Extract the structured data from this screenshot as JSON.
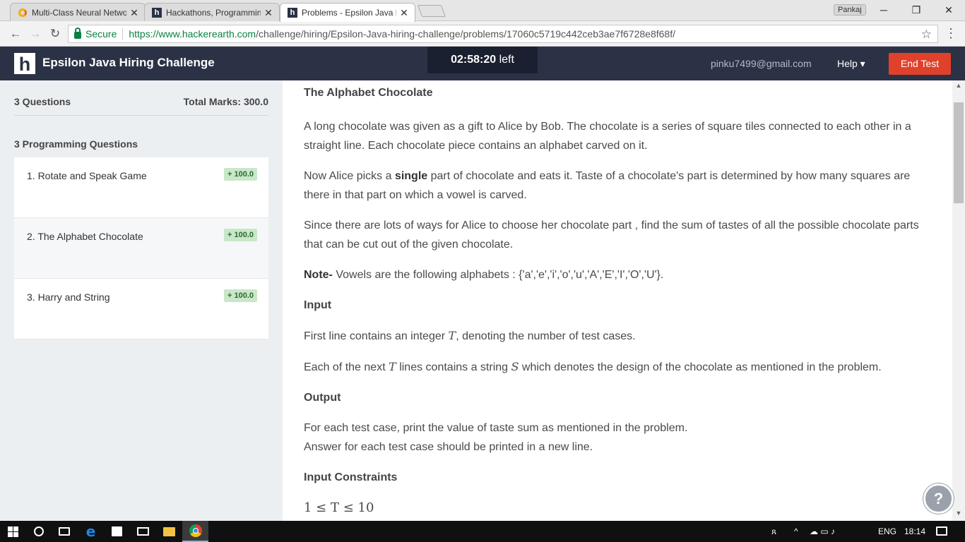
{
  "browser": {
    "tabs": [
      {
        "title": "Multi-Class Neural Netwo",
        "favicon": "colab-icon"
      },
      {
        "title": "Hackathons, Programmin",
        "favicon": "hackerearth-icon"
      },
      {
        "title": "Problems - Epsilon Java H",
        "favicon": "hackerearth-icon",
        "active": true
      }
    ],
    "close_glyph": "✕",
    "profile": "Pankaj",
    "win_min": "─",
    "win_restore": "❐",
    "win_close": "✕",
    "back": "←",
    "forward": "→",
    "reload": "↻",
    "secure_label": "Secure",
    "url_host": "https://www.hackerearth.com",
    "url_path": "/challenge/hiring/Epsilon-Java-hiring-challenge/problems/17060c5719c442ceb3ae7f6728e8f68f/",
    "star": "☆",
    "menu": "⋮"
  },
  "header": {
    "logo": "h",
    "title": "Epsilon Java Hiring Challenge",
    "timer_value": "02:58:20",
    "timer_suffix": "left",
    "email": "pinku7499@gmail.com",
    "help": "Help ▾",
    "end_test": "End Test"
  },
  "sidebar": {
    "question_count": "3 Questions",
    "total_marks": "Total Marks: 300.0",
    "section_heading": "3 Programming Questions",
    "questions": [
      {
        "label": "1. Rotate and Speak Game",
        "marks": "+ 100.0"
      },
      {
        "label": "2. The Alphabet Chocolate",
        "marks": "+ 100.0"
      },
      {
        "label": "3. Harry and String",
        "marks": "+ 100.0"
      }
    ]
  },
  "problem": {
    "title": "The Alphabet Chocolate",
    "p1": "A long chocolate was given as a gift to Alice by Bob. The chocolate is a series of square tiles connected to each other in a straight line. Each chocolate piece contains an alphabet carved on it.",
    "p2_a": "Now Alice picks a ",
    "p2_b": "single",
    "p2_c": " part of chocolate and eats it. Taste of a chocolate's part is determined by how many squares are there in that part on which a vowel is carved.",
    "p3": "Since there are lots of ways for Alice to choose her chocolate part , find the sum of tastes of all the possible chocolate parts that can be cut out of the given chocolate.",
    "note_label": "Note-",
    "note_text": " Vowels are the following alphabets :  {'a','e','i','o','u','A','E','I','O','U'}.",
    "input_heading": "Input",
    "input_1a": "First line contains an integer ",
    "input_1_var": "T",
    "input_1b": ", denoting the number of test cases.",
    "input_2a": "Each of the next ",
    "input_2_var1": "T",
    "input_2b": " lines contains a string ",
    "input_2_var2": "S",
    "input_2c": " which denotes the design of the chocolate as mentioned in the problem.",
    "output_heading": "Output",
    "output_1": "For each test case, print the value of taste sum as mentioned in the problem.",
    "output_2": "Answer for each test case should be printed in a new line.",
    "constraints_heading": "Input Constraints",
    "constraint_1": "1 ≤ T ≤ 10"
  },
  "help_bubble": "?",
  "taskbar": {
    "tray_people": "ጸ",
    "tray_chevron": "^",
    "tray_icons": "☁ ▭ ♪",
    "language": "ENG",
    "time": "18:14"
  }
}
